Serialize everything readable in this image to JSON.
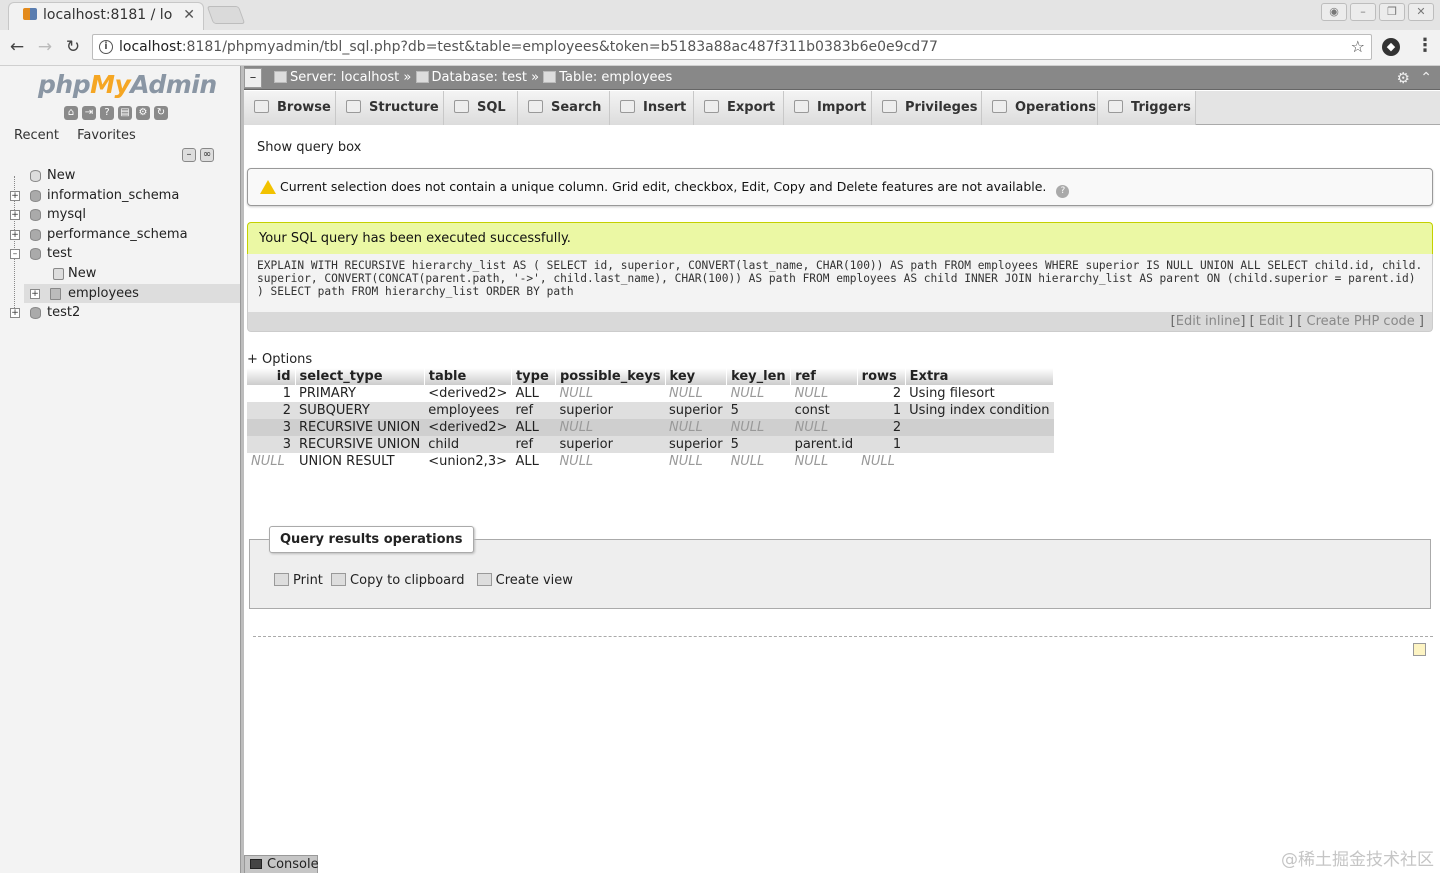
{
  "browser": {
    "tab_title": "localhost:8181 / lo",
    "url_host": "localhost",
    "url_rest": ":8181/phpmyadmin/tbl_sql.php?db=test&table=employees&token=b5183a88ac487f311b0383b6e0e9cd77"
  },
  "sidebar": {
    "logo_php": "php",
    "logo_my": "My",
    "logo_admin": "Admin",
    "tab_recent": "Recent",
    "tab_favorites": "Favorites",
    "tree": {
      "new_top": "New",
      "information_schema": "information_schema",
      "mysql": "mysql",
      "performance_schema": "performance_schema",
      "test": "test",
      "test_new": "New",
      "employees": "employees",
      "test2": "test2"
    }
  },
  "topbar": {
    "server": "Server: localhost",
    "database": "Database: test",
    "table": "Table: employees"
  },
  "tabs": {
    "browse": "Browse",
    "structure": "Structure",
    "sql": "SQL",
    "search": "Search",
    "insert": "Insert",
    "export": "Export",
    "import": "Import",
    "privileges": "Privileges",
    "operations": "Operations",
    "triggers": "Triggers"
  },
  "main": {
    "show_query_box": "Show query box",
    "warning": "Current selection does not contain a unique column. Grid edit, checkbox, Edit, Copy and Delete features are not available.",
    "success": "Your SQL query has been executed successfully.",
    "sql_query": "EXPLAIN WITH RECURSIVE hierarchy_list AS ( SELECT id, superior, CONVERT(last_name, CHAR(100)) AS path FROM employees WHERE superior IS NULL UNION ALL SELECT child.id, child.superior, CONVERT(CONCAT(parent.path, '->', child.last_name), CHAR(100)) AS path FROM employees AS child INNER JOIN hierarchy_list AS parent ON (child.superior = parent.id) ) SELECT path FROM hierarchy_list ORDER BY path",
    "edit_inline": "Edit inline",
    "edit": "Edit",
    "create_php": "Create PHP code",
    "options": "+ Options",
    "columns": [
      "id",
      "select_type",
      "table",
      "type",
      "possible_keys",
      "key",
      "key_len",
      "ref",
      "rows",
      "Extra"
    ],
    "rows": [
      [
        "1",
        "PRIMARY",
        "<derived2>",
        "ALL",
        "NULL",
        "NULL",
        "NULL",
        "NULL",
        "2",
        "Using filesort"
      ],
      [
        "2",
        "SUBQUERY",
        "employees",
        "ref",
        "superior",
        "superior",
        "5",
        "const",
        "1",
        "Using index condition"
      ],
      [
        "3",
        "RECURSIVE UNION",
        "<derived2>",
        "ALL",
        "NULL",
        "NULL",
        "NULL",
        "NULL",
        "2",
        ""
      ],
      [
        "3",
        "RECURSIVE UNION",
        "child",
        "ref",
        "superior",
        "superior",
        "5",
        "parent.id",
        "1",
        ""
      ],
      [
        "NULL",
        "UNION RESULT",
        "<union2,3>",
        "ALL",
        "NULL",
        "NULL",
        "NULL",
        "NULL",
        "NULL",
        ""
      ]
    ],
    "qro_title": "Query results operations",
    "print": "Print",
    "copy_clipboard": "Copy to clipboard",
    "create_view": "Create view",
    "console": "Console"
  },
  "watermark": "@稀土掘金技术社区"
}
